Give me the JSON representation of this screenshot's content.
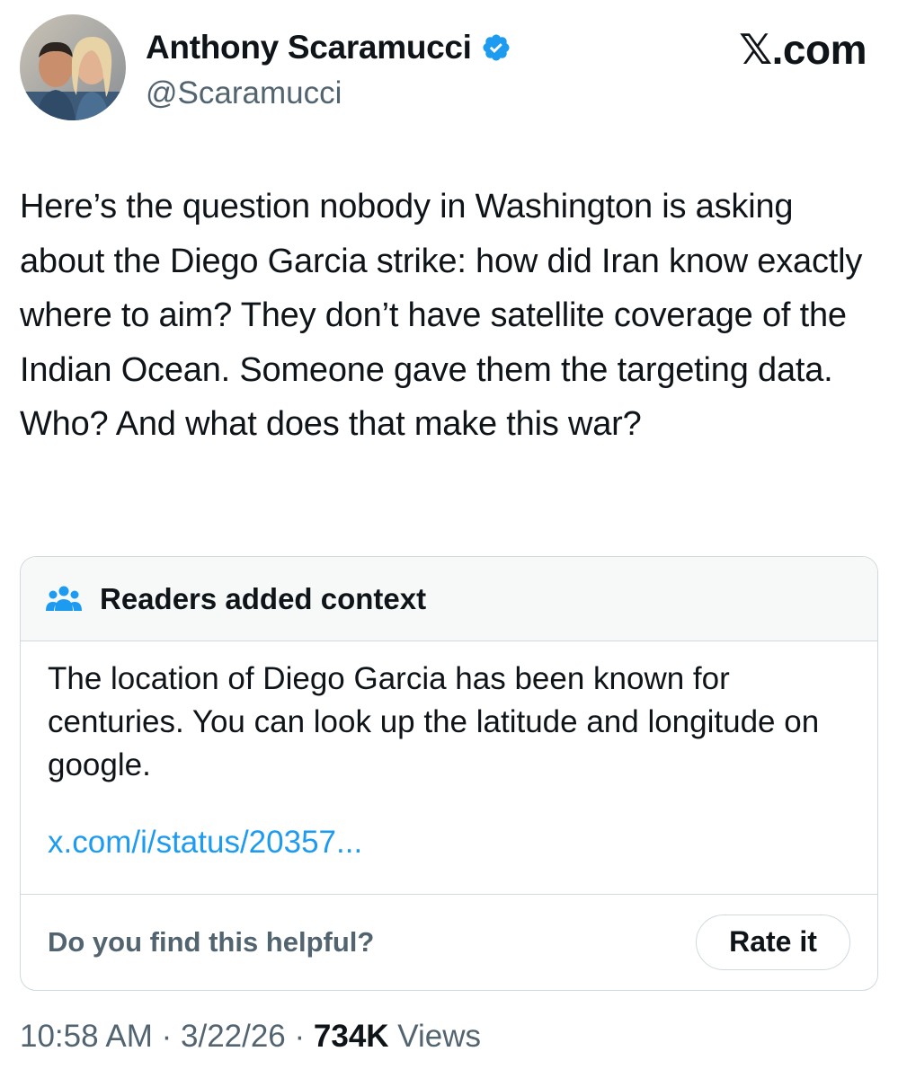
{
  "author": {
    "display_name": "Anthony Scaramucci",
    "handle": "@Scaramucci",
    "verified": true,
    "avatar_icon": "avatar-photo"
  },
  "brand": {
    "logo_text": "𝕏.com"
  },
  "tweet": {
    "text": "Here’s the question nobody in Washington is asking about the Diego Garcia strike: how did Iran know exactly where to aim? They don’t have satellite coverage of the Indian Ocean. Someone gave them the targeting data. Who? And what does that make this war?"
  },
  "community_note": {
    "title": "Readers added context",
    "icon": "people-icon",
    "note": "The location of Diego Garcia has been known for centuries. You can look up the latitude and longitude on google.",
    "link_text": "x.com/i/status/20357...",
    "helpful_question": "Do you find this helpful?",
    "rate_label": "Rate it"
  },
  "meta": {
    "time": "10:58 AM",
    "separator": " · ",
    "date": "3/22/26",
    "views_count": "734K",
    "views_label": "Views"
  },
  "colors": {
    "accent": "#1d9bf0",
    "text": "#0f1419",
    "muted": "#536471",
    "border": "#cfd9de",
    "header_bg": "#f7f9f9"
  }
}
